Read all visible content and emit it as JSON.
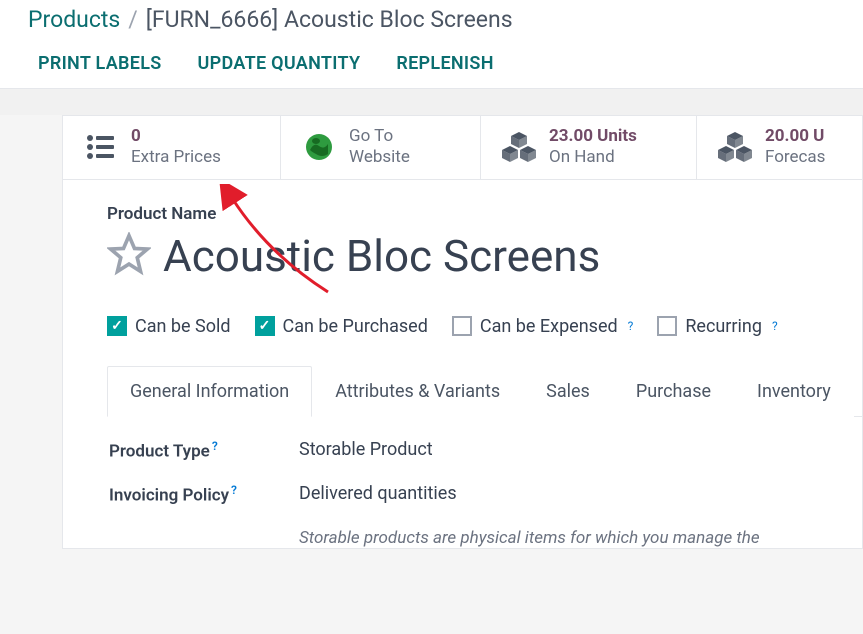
{
  "breadcrumb": {
    "root": "Products",
    "current": "[FURN_6666] Acoustic Bloc Screens"
  },
  "toolbar": {
    "print_labels": "PRINT LABELS",
    "update_quantity": "UPDATE QUANTITY",
    "replenish": "REPLENISH"
  },
  "stats": {
    "extra_prices": {
      "value": "0",
      "label": "Extra Prices"
    },
    "website": {
      "line1": "Go To",
      "line2": "Website"
    },
    "on_hand": {
      "value": "23.00 Units",
      "label": "On Hand"
    },
    "forecasted": {
      "value": "20.00 U",
      "label": "Forecas"
    }
  },
  "product": {
    "name_label": "Product Name",
    "name": "Acoustic Bloc Screens"
  },
  "checks": {
    "sold": "Can be Sold",
    "purchased": "Can be Purchased",
    "expensed": "Can be Expensed",
    "recurring": "Recurring"
  },
  "tabs": {
    "general": "General Information",
    "attrs": "Attributes & Variants",
    "sales": "Sales",
    "purchase": "Purchase",
    "inventory": "Inventory"
  },
  "fields": {
    "product_type_label": "Product Type",
    "product_type_value": "Storable Product",
    "invoicing_policy_label": "Invoicing Policy",
    "invoicing_policy_value": "Delivered quantities",
    "help_text": "Storable products are physical items for which you manage the"
  }
}
